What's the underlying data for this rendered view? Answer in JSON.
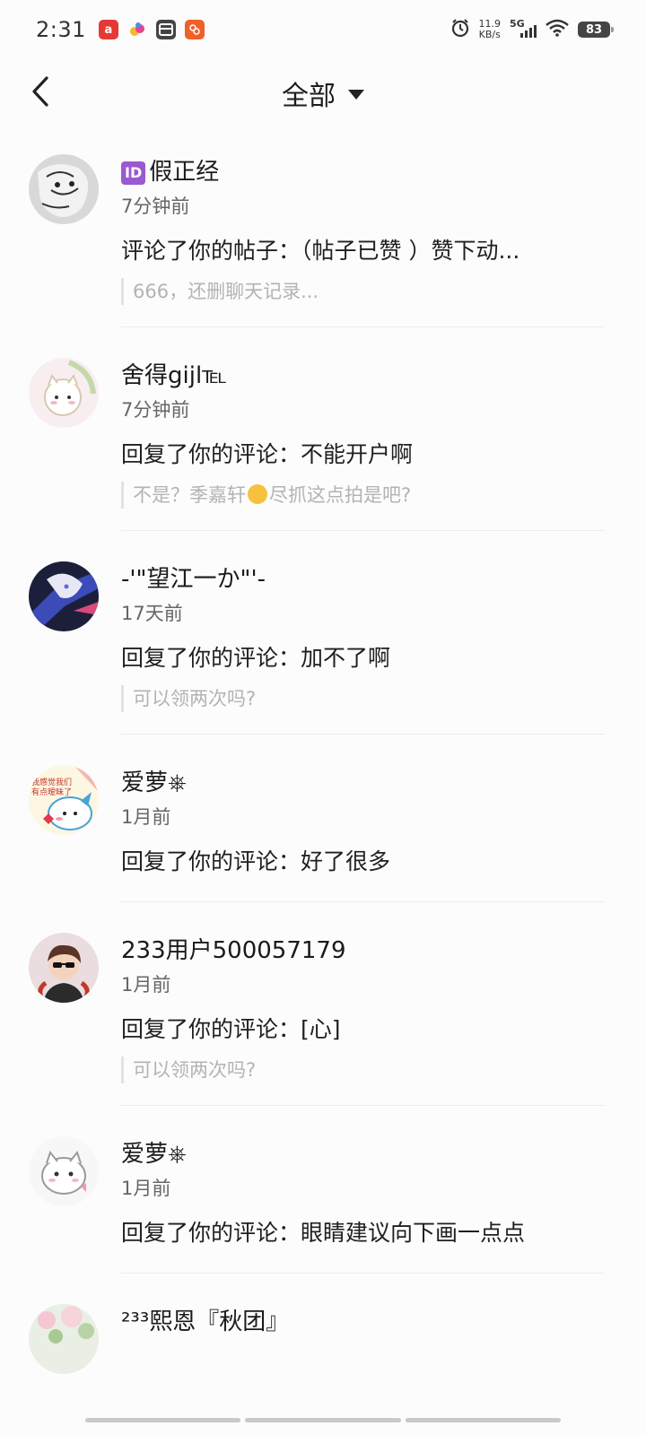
{
  "status_bar": {
    "time": "2:31",
    "net_speed_value": "11.9",
    "net_speed_unit": "KB/s",
    "network": "5G",
    "battery": "83",
    "app_icons": [
      "app-a-icon",
      "app-balloon-icon",
      "app-card-icon",
      "app-orange-icon"
    ]
  },
  "nav": {
    "title": "全部"
  },
  "notifications": [
    {
      "badge": "ID",
      "username": "假正经",
      "time": "7分钟前",
      "content": "评论了你的帖子：（帖子已赞 ）赞下动...",
      "quote": "666，还删聊天记录..."
    },
    {
      "username": "舍得gijl℡",
      "time": "7分钟前",
      "content": "回复了你的评论：不能开户啊",
      "quote_before": "不是？季嘉轩",
      "quote_after": "尽抓这点拍是吧?"
    },
    {
      "username": "-'\"望江一か\"'-",
      "time": "17天前",
      "content": "回复了你的评论：加不了啊",
      "quote": "可以领两次吗?"
    },
    {
      "username": "爱萝⎈",
      "time": "1月前",
      "content": "回复了你的评论：好了很多",
      "avatar_text": "我感觉我们有点暧昧了"
    },
    {
      "username": "233用户500057179",
      "time": "1月前",
      "content": "回复了你的评论：[心]",
      "quote": "可以领两次吗?"
    },
    {
      "username": "爱萝⎈",
      "time": "1月前",
      "content": "回复了你的评论：眼睛建议向下画一点点"
    },
    {
      "username": "²³³熙恩『秋团』"
    }
  ],
  "colors": {
    "background": "#fcfcfd",
    "quote_text": "#b3b3b3",
    "id_badge": "#9b59d0"
  }
}
